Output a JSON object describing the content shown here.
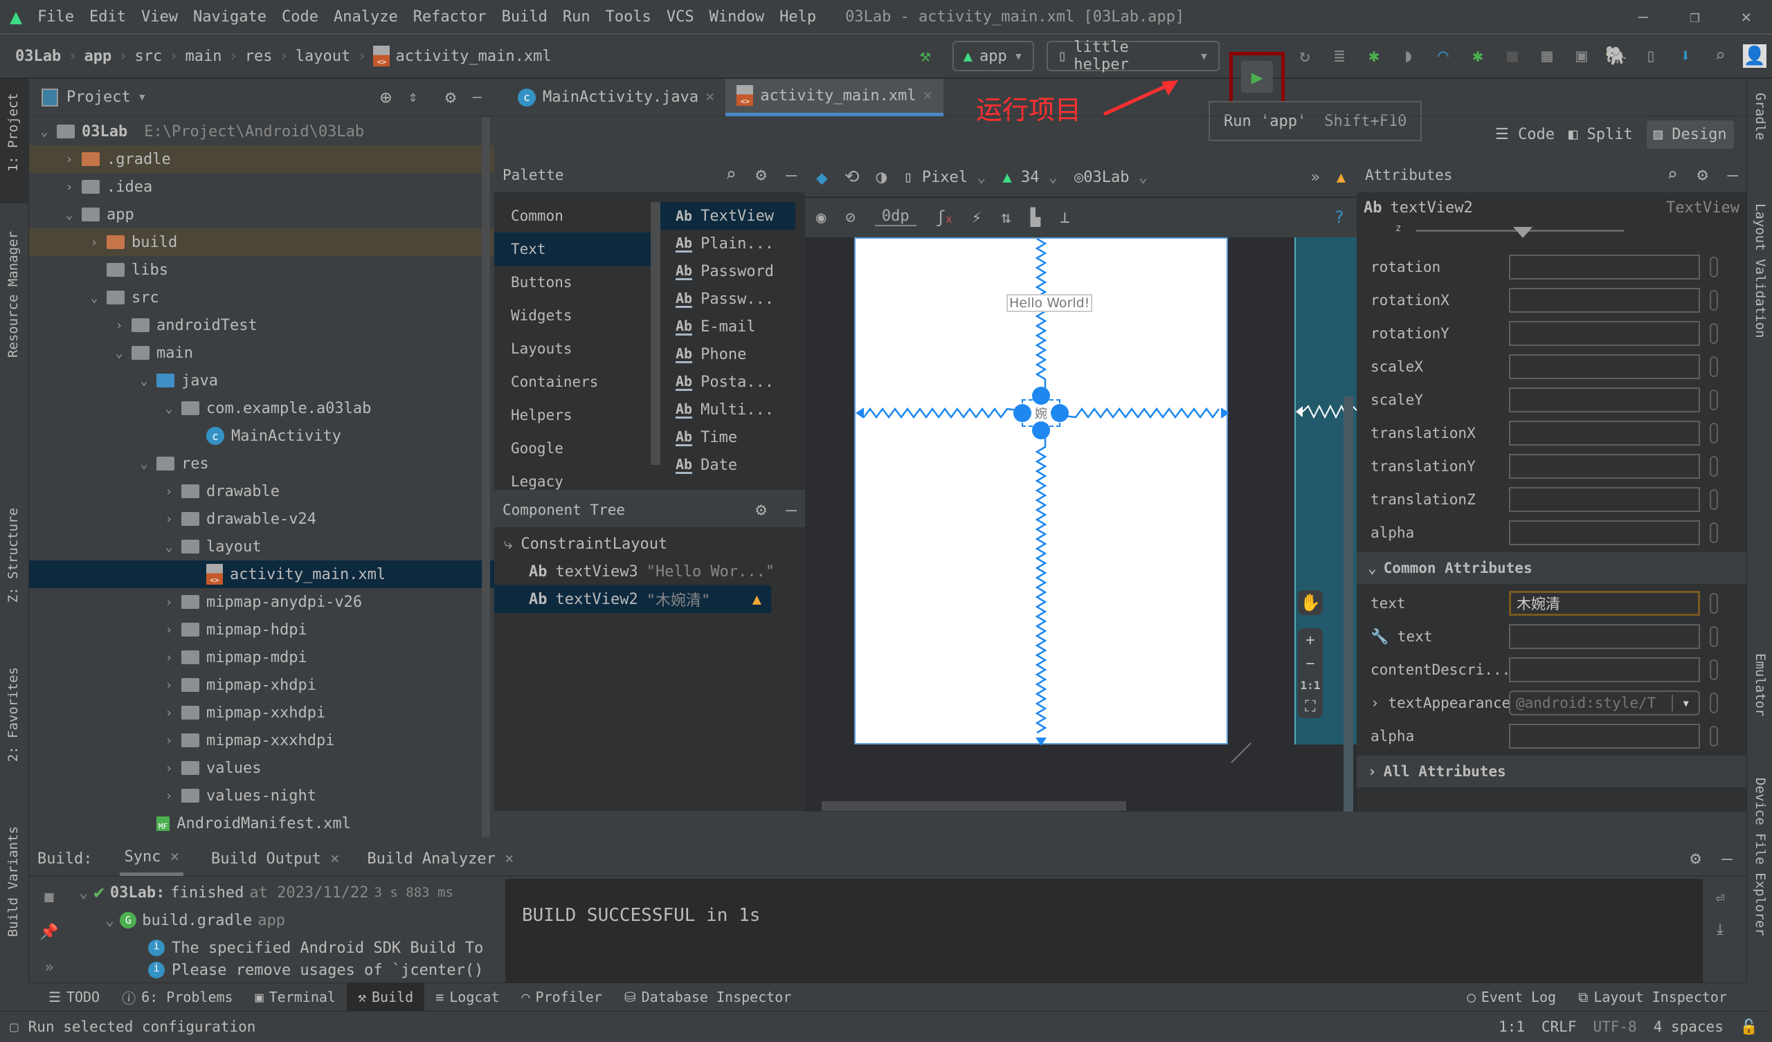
{
  "window": {
    "title": "03Lab - activity_main.xml [03Lab.app]"
  },
  "menu": [
    "File",
    "Edit",
    "View",
    "Navigate",
    "Code",
    "Analyze",
    "Refactor",
    "Build",
    "Run",
    "Tools",
    "VCS",
    "Window",
    "Help"
  ],
  "breadcrumb": [
    "03Lab",
    "app",
    "src",
    "main",
    "res",
    "layout",
    "activity_main.xml"
  ],
  "toolbar": {
    "run_config": "app",
    "device": "little helper",
    "run_tooltip": "Run 'app'",
    "run_shortcut": "Shift+F10"
  },
  "annotation": {
    "label": "运行项目",
    "color": "#ff3030",
    "box_color": "#8b0000"
  },
  "project": {
    "title": "Project",
    "root": {
      "name": "03Lab",
      "path": "E:\\Project\\Android\\03Lab"
    },
    "items": [
      {
        "label": ".gradle",
        "level": 1,
        "expand": ">",
        "color": "orange",
        "hl": true
      },
      {
        "label": ".idea",
        "level": 1,
        "expand": ">",
        "color": "gray"
      },
      {
        "label": "app",
        "level": 1,
        "expand": "v",
        "color": "gray"
      },
      {
        "label": "build",
        "level": 2,
        "expand": ">",
        "color": "orange",
        "hl": true
      },
      {
        "label": "libs",
        "level": 2,
        "expand": "",
        "color": "gray"
      },
      {
        "label": "src",
        "level": 2,
        "expand": "v",
        "color": "gray"
      },
      {
        "label": "androidTest",
        "level": 3,
        "expand": ">",
        "color": "gray"
      },
      {
        "label": "main",
        "level": 3,
        "expand": "v",
        "color": "gray"
      },
      {
        "label": "java",
        "level": 4,
        "expand": "v",
        "color": "blue"
      },
      {
        "label": "com.example.a03lab",
        "level": 5,
        "expand": "v",
        "color": "gray"
      },
      {
        "label": "MainActivity",
        "level": 6,
        "expand": "",
        "color": "class"
      },
      {
        "label": "res",
        "level": 4,
        "expand": "v",
        "color": "gray"
      },
      {
        "label": "drawable",
        "level": 5,
        "expand": ">",
        "color": "gray"
      },
      {
        "label": "drawable-v24",
        "level": 5,
        "expand": ">",
        "color": "gray"
      },
      {
        "label": "layout",
        "level": 5,
        "expand": "v",
        "color": "gray"
      },
      {
        "label": "activity_main.xml",
        "level": 6,
        "expand": "",
        "color": "xml",
        "sel": true
      },
      {
        "label": "mipmap-anydpi-v26",
        "level": 5,
        "expand": ">",
        "color": "gray"
      },
      {
        "label": "mipmap-hdpi",
        "level": 5,
        "expand": ">",
        "color": "gray"
      },
      {
        "label": "mipmap-mdpi",
        "level": 5,
        "expand": ">",
        "color": "gray"
      },
      {
        "label": "mipmap-xhdpi",
        "level": 5,
        "expand": ">",
        "color": "gray"
      },
      {
        "label": "mipmap-xxhdpi",
        "level": 5,
        "expand": ">",
        "color": "gray"
      },
      {
        "label": "mipmap-xxxhdpi",
        "level": 5,
        "expand": ">",
        "color": "gray"
      },
      {
        "label": "values",
        "level": 5,
        "expand": ">",
        "color": "gray"
      },
      {
        "label": "values-night",
        "level": 5,
        "expand": ">",
        "color": "gray"
      },
      {
        "label": "AndroidManifest.xml",
        "level": 4,
        "expand": "",
        "color": "manifest"
      }
    ]
  },
  "editor_tabs": [
    {
      "label": "MainActivity.java",
      "active": false
    },
    {
      "label": "activity_main.xml",
      "active": true
    }
  ],
  "view_modes": [
    "Code",
    "Split",
    "Design"
  ],
  "palette": {
    "title": "Palette",
    "categories": [
      "Common",
      "Text",
      "Buttons",
      "Widgets",
      "Layouts",
      "Containers",
      "Helpers",
      "Google",
      "Legacy"
    ],
    "selected_category": "Text",
    "items": [
      "TextView",
      "Plain...",
      "Password",
      "Passw...",
      "E-mail",
      "Phone",
      "Posta...",
      "Multi...",
      "Time",
      "Date"
    ]
  },
  "component_tree": {
    "title": "Component Tree",
    "root": "ConstraintLayout",
    "items": [
      {
        "id": "textView3",
        "text": "\"Hello Wor...\""
      },
      {
        "id": "textView2",
        "text": "\"木婉清\"",
        "warning": true
      }
    ]
  },
  "design_toolbar": {
    "device": "Pixel",
    "api": "34",
    "theme": "03Lab",
    "margin": "0dp"
  },
  "canvas": {
    "hello": "Hello World!",
    "selected_text": "婉",
    "zoom_reset": "1:1"
  },
  "attributes": {
    "title": "Attributes",
    "view_id": "textView2",
    "view_type": "TextView",
    "transform_rows": [
      "rotation",
      "rotationX",
      "rotationY",
      "scaleX",
      "scaleY",
      "translationX",
      "translationY",
      "translationZ",
      "alpha"
    ],
    "common_section": "Common Attributes",
    "common_rows": [
      {
        "label": "text",
        "value": "木婉清",
        "highlight": true
      },
      {
        "label": "text",
        "value": "",
        "tool": true
      },
      {
        "label": "contentDescri...",
        "value": ""
      },
      {
        "label": "textAppearance",
        "value": "@android:style/T",
        "dropdown": true
      },
      {
        "label": "alpha",
        "value": ""
      }
    ],
    "all_section": "All Attributes"
  },
  "build": {
    "label": "Build:",
    "tabs": [
      "Sync",
      "Build Output",
      "Build Analyzer"
    ],
    "tree": [
      {
        "bold": "03Lab:",
        "text": "finished",
        "dim": "at 2023/11/22",
        "time": "3 s 883 ms"
      },
      {
        "text": "build.gradle",
        "dim": "app"
      },
      {
        "text": "The specified Android SDK Build To"
      },
      {
        "text": "Please remove usages of `jcenter()"
      }
    ],
    "output": "BUILD SUCCESSFUL in 1s"
  },
  "bottom_tools": [
    "TODO",
    "6: Problems",
    "Terminal",
    "Build",
    "Logcat",
    "Profiler",
    "Database Inspector"
  ],
  "bottom_right_tools": [
    "Event Log",
    "Layout Inspector"
  ],
  "left_stripe": [
    "1: Project",
    "Resource Manager",
    "Z: Structure",
    "2: Favorites",
    "Build Variants"
  ],
  "right_stripe": [
    "Gradle",
    "Layout Validation",
    "Emulator",
    "Device File Explorer"
  ],
  "status": {
    "message": "Run selected configuration",
    "position": "1:1",
    "line_sep": "CRLF",
    "encoding": "UTF-8",
    "indent": "4 spaces"
  }
}
